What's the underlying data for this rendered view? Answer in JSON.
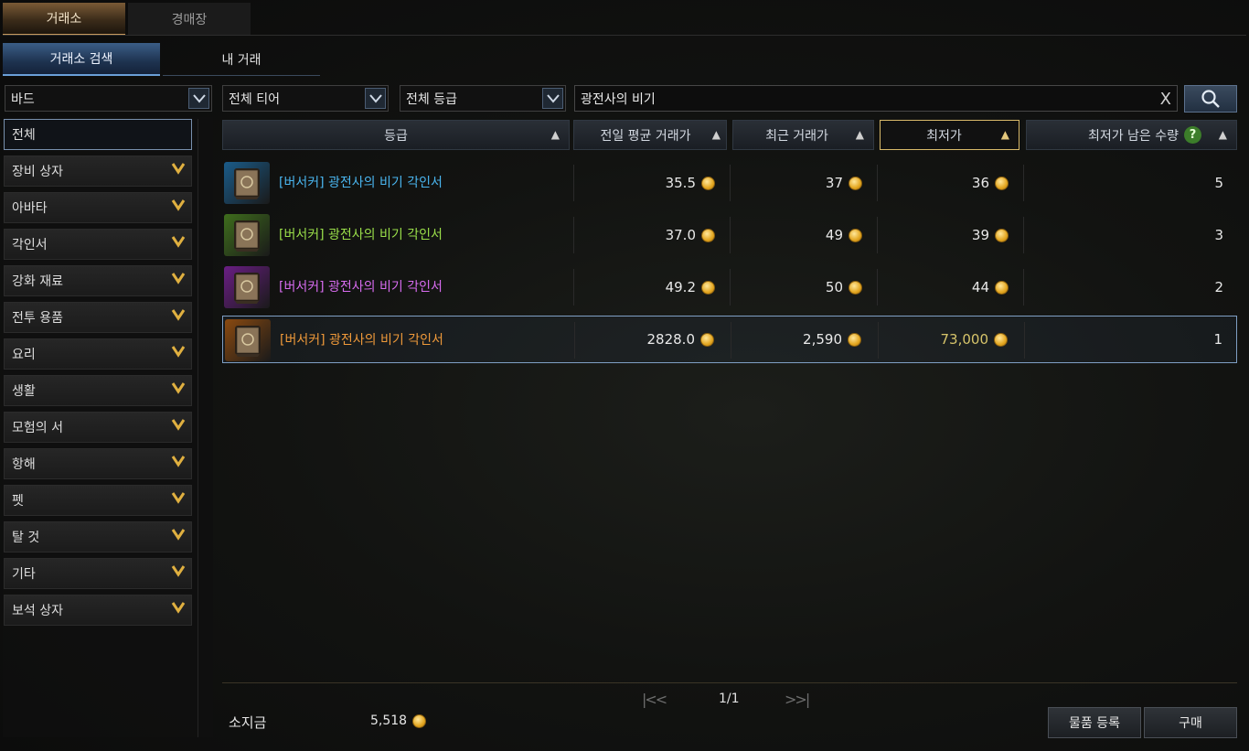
{
  "top_tabs": [
    "거래소",
    "경매장"
  ],
  "sub_tabs": [
    "거래소 검색",
    "내 거래"
  ],
  "filters": {
    "class": "바드",
    "tier": "전체 티어",
    "grade": "전체 등급",
    "search_value": "광전사의 비기",
    "clear_symbol": "X"
  },
  "categories": [
    "전체",
    "장비 상자",
    "아바타",
    "각인서",
    "강화 재료",
    "전투 용품",
    "요리",
    "생활",
    "모험의 서",
    "항해",
    "펫",
    "탈 것",
    "기타",
    "보석 상자"
  ],
  "table": {
    "headers": {
      "grade": "등급",
      "avg_price": "전일 평균 거래가",
      "recent_price": "최근 거래가",
      "lowest_price": "최저가",
      "lowest_qty": "최저가 남은 수량",
      "help": "?"
    },
    "rows": [
      {
        "name": "[버서커] 광전사의 비기 각인서",
        "avg": "35.5",
        "recent": "37",
        "lowest": "36",
        "qty": "5",
        "color": "#4ab6f0",
        "icon_bg": "#1a5c8a"
      },
      {
        "name": "[버서커] 광전사의 비기 각인서",
        "avg": "37.0",
        "recent": "49",
        "lowest": "39",
        "qty": "3",
        "color": "#9be04a",
        "icon_bg": "#3f6e1c"
      },
      {
        "name": "[버서커] 광전사의 비기 각인서",
        "avg": "49.2",
        "recent": "50",
        "lowest": "44",
        "qty": "2",
        "color": "#d86cf0",
        "icon_bg": "#6a1e84"
      },
      {
        "name": "[버서커] 광전사의 비기 각인서",
        "avg": "2828.0",
        "recent": "2,590",
        "lowest": "73,000",
        "qty": "1",
        "color": "#f09a3a",
        "icon_bg": "#8a4a10",
        "lowest_color": "#d6c46a"
      }
    ]
  },
  "pager": {
    "current": "1/1",
    "first": "|<<",
    "last": ">>|"
  },
  "wallet": {
    "label": "소지금",
    "amount": "5,518"
  },
  "buttons": {
    "register": "물품 등록",
    "buy": "구매"
  }
}
